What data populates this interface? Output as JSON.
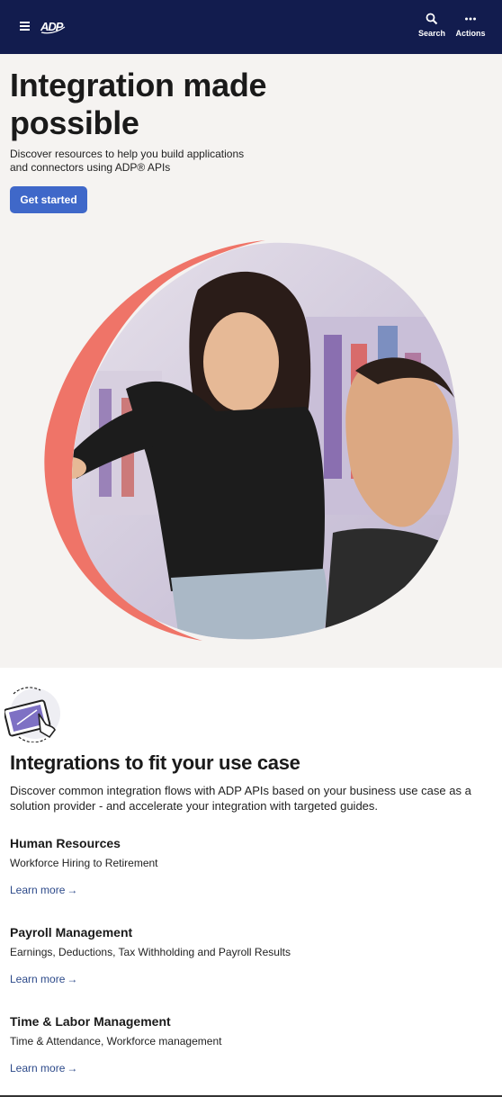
{
  "header": {
    "brand": "ADP",
    "search_label": "Search",
    "actions_label": "Actions",
    "background": "#121c4e"
  },
  "hero": {
    "title": "Integration made possible",
    "description": "Discover resources to help you build applications and connectors using ADP® APIs",
    "cta_label": "Get started",
    "cta_color": "#3f68c9",
    "accent_color": "#ef7468"
  },
  "use_cases": {
    "title": "Integrations to fit your use case",
    "description": "Discover common integration flows with ADP APIs based on your business use case as a solution provider - and accelerate your integration with targeted guides.",
    "items": [
      {
        "title": "Human Resources",
        "subtitle": "Workforce Hiring to Retirement",
        "link": "Learn more"
      },
      {
        "title": "Payroll Management",
        "subtitle": "Earnings, Deductions, Tax Withholding and Payroll Results",
        "link": "Learn more"
      },
      {
        "title": "Time & Labor Management",
        "subtitle": "Time & Attendance, Workforce management",
        "link": "Learn more"
      }
    ]
  }
}
